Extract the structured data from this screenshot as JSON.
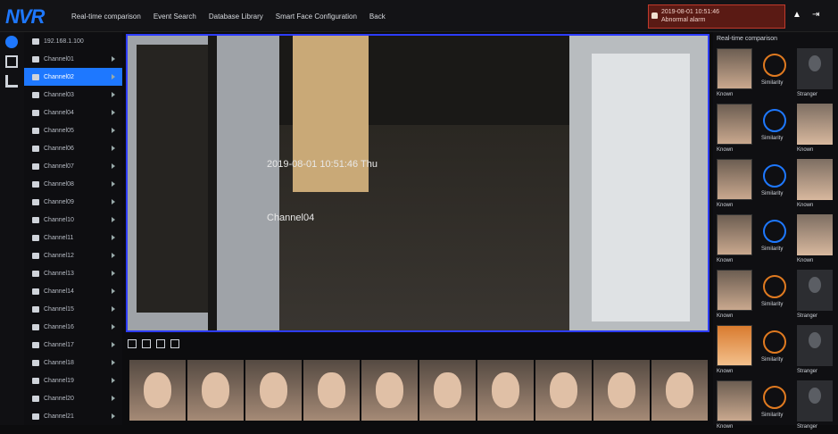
{
  "app": {
    "logo": "NVR"
  },
  "nav": [
    "Real-time comparison",
    "Event Search",
    "Database Library",
    "Smart Face Configuration",
    "Back"
  ],
  "alert": {
    "line1": "2019-08-01 10:51:46",
    "line2": "Abnormal alarm"
  },
  "tree": {
    "root": "192.168.1.100",
    "channels": [
      "Channel01",
      "Channel02",
      "Channel03",
      "Channel04",
      "Channel05",
      "Channel06",
      "Channel07",
      "Channel08",
      "Channel09",
      "Channel10",
      "Channel11",
      "Channel12",
      "Channel13",
      "Channel14",
      "Channel15",
      "Channel16",
      "Channel17",
      "Channel18",
      "Channel19",
      "Channel20",
      "Channel21"
    ],
    "selected_index": 1
  },
  "video": {
    "timestamp": "2019-08-01 10:51:46 Thu",
    "channel_label": "Channel04"
  },
  "right_panel": {
    "title": "Real-time comparison",
    "items": [
      {
        "pct": "Similarity",
        "left": "Known",
        "right": "Stranger",
        "ring": "orange"
      },
      {
        "pct": "Similarity",
        "left": "Known",
        "right": "Known",
        "ring": "blue"
      },
      {
        "pct": "Similarity",
        "left": "Known",
        "right": "Known",
        "ring": "blue"
      },
      {
        "pct": "Similarity",
        "left": "Known",
        "right": "Known",
        "ring": "blue"
      },
      {
        "pct": "Similarity",
        "left": "Known",
        "right": "Stranger",
        "ring": "orange"
      },
      {
        "pct": "Similarity",
        "left": "Known",
        "right": "Stranger",
        "ring": "orange"
      },
      {
        "pct": "Similarity",
        "left": "Known",
        "right": "Stranger",
        "ring": "orange"
      }
    ]
  },
  "colors": {
    "accent": "#1e78ff",
    "alert": "#c0392b",
    "video_border": "#2d3cff"
  }
}
